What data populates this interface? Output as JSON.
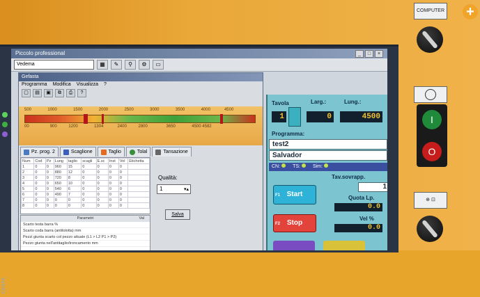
{
  "outer_window": {
    "title": "Piccolo professional",
    "selector_value": "Vedema"
  },
  "inner_window": {
    "title": "Gefasta",
    "menu": [
      "Programma",
      "Modifica",
      "Visualizza",
      "?"
    ]
  },
  "gauge": {
    "scale_top": [
      "500",
      "1000",
      "1500",
      "2000",
      "2500",
      "3000",
      "3500",
      "4000",
      "4500"
    ],
    "scale_bottom": [
      "00",
      "900",
      "1200",
      "1304",
      "2400",
      "2800",
      "3650",
      "4500",
      "4582"
    ]
  },
  "tabs": [
    "Pz. prog. 2",
    "Scaglione",
    "Taglio",
    "Tolal",
    "Tansazione"
  ],
  "grid": {
    "headers": [
      "Num",
      "Cod",
      "Pz",
      "Lung",
      "taglio",
      "scagli",
      "E.sc",
      "Inst",
      "Vol",
      "Etichetta"
    ],
    "rows": [
      [
        "1",
        "0",
        "0",
        "960",
        "15",
        "0",
        "0",
        "0",
        "0"
      ],
      [
        "2",
        "0",
        "0",
        "880",
        "12",
        "0",
        "0",
        "0",
        "0"
      ],
      [
        "3",
        "0",
        "0",
        "720",
        "8",
        "0",
        "0",
        "0",
        "0"
      ],
      [
        "4",
        "0",
        "0",
        "650",
        "10",
        "0",
        "0",
        "0",
        "0"
      ],
      [
        "5",
        "0",
        "0",
        "540",
        "6",
        "0",
        "0",
        "0",
        "0"
      ],
      [
        "6",
        "0",
        "0",
        "490",
        "7",
        "0",
        "0",
        "0",
        "0"
      ],
      [
        "7",
        "0",
        "0",
        "0",
        "0",
        "0",
        "0",
        "0",
        "0"
      ],
      [
        "8",
        "0",
        "0",
        "0",
        "0",
        "0",
        "0",
        "0",
        "0"
      ]
    ]
  },
  "quality": {
    "label": "Qualità:",
    "value": "1",
    "button": "Salva"
  },
  "params": {
    "header": "Parametri",
    "col": "Val",
    "rows": [
      "Scarto testa barra %",
      "Scarto coda barra (antitolotta) mm",
      "Pezzi giunta scarto col pezzo attuale (L1 > L2 P1 > P2)",
      "Pezzo giunta nell'antitaglio/troncamento mm"
    ]
  },
  "panel": {
    "tavola_label": "Tavola",
    "larg_label": "Larg.:",
    "lung_label": "Lung.:",
    "tavola_value": "1",
    "larg_value": "0",
    "lung_value": "4500",
    "programma_label": "Programma:",
    "programma_value": "test2",
    "operator": "Salvador",
    "status": {
      "cn": "CN:",
      "ts": "TS:",
      "sim": "Sim:"
    },
    "tav_sovrapp_label": "Tav.sovrapp.",
    "tav_sovrapp_value": "1",
    "quota_label": "Quota Lp.",
    "quota_value": "0.0",
    "vel_label": "Vel %",
    "vel_value": "0.0",
    "start_key": "F1",
    "start_label": "Start",
    "stop_key": "F2",
    "stop_label": "Stop"
  },
  "hardware": {
    "top_plate": "COMPUTER",
    "green_button": "I",
    "red_button": "O",
    "side_label": "CENTA"
  }
}
